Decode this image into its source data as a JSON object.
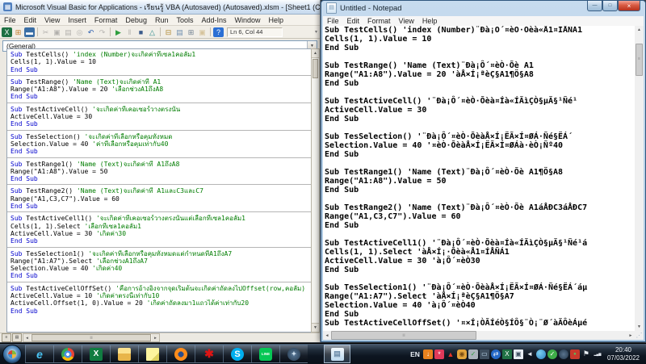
{
  "vba": {
    "title": "Microsoft Visual Basic for Applications - เรียนรู้ VBA (Autosaved) (Autosaved).xlsm - [Sheet1 (Code)]",
    "icon_glyph": "▦",
    "menus": [
      "File",
      "Edit",
      "View",
      "Insert",
      "Format",
      "Debug",
      "Run",
      "Tools",
      "Add-Ins",
      "Window",
      "Help"
    ],
    "status": "Ln 6, Col 44",
    "combo": "(General)",
    "toolbar": [
      {
        "name": "view-excel-icon",
        "glyph": "X",
        "fg": "#ffffff",
        "bg": "#1d6f42",
        "dim": false
      },
      {
        "name": "insert-userform-icon",
        "glyph": "⊞",
        "fg": "#c07a28",
        "bg": "",
        "dim": false
      },
      {
        "name": "save-icon",
        "glyph": "▬",
        "fg": "#ffffff",
        "bg": "#3a6ea5",
        "dim": false
      },
      {
        "name": "cut-icon",
        "glyph": "✂",
        "fg": "#555555",
        "bg": "",
        "dim": true
      },
      {
        "name": "copy-icon",
        "glyph": "▣",
        "fg": "#555555",
        "bg": "",
        "dim": true
      },
      {
        "name": "paste-icon",
        "glyph": "▤",
        "fg": "#555555",
        "bg": "",
        "dim": true
      },
      {
        "name": "find-icon",
        "glyph": "◎",
        "fg": "#555555",
        "bg": "",
        "dim": true
      },
      {
        "name": "undo-icon",
        "glyph": "↶",
        "fg": "#2b5fb0",
        "bg": "",
        "dim": false
      },
      {
        "name": "redo-icon",
        "glyph": "↷",
        "fg": "#666666",
        "bg": "",
        "dim": true
      },
      {
        "name": "run-icon",
        "glyph": "▶",
        "fg": "#2e9e3e",
        "bg": "",
        "dim": false
      },
      {
        "name": "break-icon",
        "glyph": "‖",
        "fg": "#555555",
        "bg": "",
        "dim": true
      },
      {
        "name": "reset-icon",
        "glyph": "■",
        "fg": "#3a5a8a",
        "bg": "",
        "dim": false
      },
      {
        "name": "design-mode-icon",
        "glyph": "△",
        "fg": "#2a8a8a",
        "bg": "",
        "dim": false
      },
      {
        "name": "project-explorer-icon",
        "glyph": "⊟",
        "fg": "#b08830",
        "bg": "",
        "dim": false
      },
      {
        "name": "properties-window-icon",
        "glyph": "▤",
        "fg": "#7090b0",
        "bg": "",
        "dim": false
      },
      {
        "name": "object-browser-icon",
        "glyph": "⊞",
        "fg": "#708090",
        "bg": "",
        "dim": false
      },
      {
        "name": "toolbox-icon",
        "glyph": "▣",
        "fg": "#b08830",
        "bg": "",
        "dim": true
      },
      {
        "name": "help-icon",
        "glyph": "?",
        "fg": "#ffffff",
        "bg": "#2b6fd4",
        "dim": false
      }
    ],
    "blocks": [
      [
        {
          "kw": "Sub",
          "code": " TestCells() ",
          "cmt": "'index (Number)จะเกิดค่าที่เซล1คอลัม1"
        },
        {
          "code": "Cells(1, 1).Value = 10"
        },
        {
          "kw": "End Sub"
        }
      ],
      [
        {
          "kw": "Sub",
          "code": " TestRange() ",
          "cmt": "'Name (Text)จะเกิดค่าที่ A1"
        },
        {
          "code": "Range(\"A1:A8\").Value = 20 ",
          "cmt": "'เลือกช่วงA1ถึงA8"
        },
        {
          "kw": "End Sub"
        }
      ],
      [
        {
          "kw": "Sub",
          "code": " TestActiveCell() ",
          "cmt": "'จะเกิดค่าที่เคอเซอร์วางตรงนั้น"
        },
        {
          "code": "ActiveCell.Value = 30"
        },
        {
          "kw": "End Sub"
        }
      ],
      [
        {
          "kw": "Sub",
          "code": " TesSelection() ",
          "cmt": "'จะเกิดค่าที่เลือกหรือคุมทั้งหมด"
        },
        {
          "code": "Selection.Value = 40 ",
          "cmt": "'ค่าที่เลือกหรือคุมเท่ากับ40"
        },
        {
          "kw": "End Sub"
        }
      ],
      [
        {
          "kw": "Sub",
          "code": " TestRange1() ",
          "cmt": "'Name (Text)จะเกิดค่าที่ A1ถึงA8"
        },
        {
          "code": "Range(\"A1:A8\").Value = 50"
        },
        {
          "kw": "End Sub"
        }
      ],
      [
        {
          "kw": "Sub",
          "code": " TestRange2() ",
          "cmt": "'Name (Text)จะเกิดค่าที่ A1และC3และC7"
        },
        {
          "code": "Range(\"A1,C3,C7\").Value = 60"
        },
        {
          "kw": "End Sub"
        }
      ],
      [
        {
          "kw": "Sub",
          "code": " TestActiveCell1() ",
          "cmt": "'จะเกิดค่าที่เคอเซอร์วางตรงนั้นแต่เลือกที่เซล1คอลัม1"
        },
        {
          "code": "Cells(1, 1).Select ",
          "cmt": "'เลือกที่เซล1คอลัม1"
        },
        {
          "code": "ActiveCell.Value = 30 ",
          "cmt": "'เกิดค่า30"
        },
        {
          "kw": "End Sub"
        }
      ],
      [
        {
          "kw": "Sub",
          "code": " TesSelection1() ",
          "cmt": "'จะเกิดค่าที่เลือกหรือคุมทั้งหมดแต่กำหนดที่A1ถึงA7"
        },
        {
          "code": "Range(\"A1:A7\").Select ",
          "cmt": "'เลือกช่วงA1ถึงA7"
        },
        {
          "code": "Selection.Value = 40 ",
          "cmt": "'เกิดค่า40"
        },
        {
          "kw": "End Sub"
        }
      ],
      [
        {
          "kw": "Sub",
          "code": " TestActiveCellOffSet() ",
          "cmt": "'คือการอ้างอิงจากจุดเริ่มต้นจะเกิดค่าถัดลงไปOffset(row,คอลัม)"
        },
        {
          "code": "ActiveCell.Value = 10 ",
          "cmt": "'เกิดค่าตรงนี้เท่ากับ10"
        },
        {
          "code": "ActiveCell.Offset(1, 0).Value = 20 ",
          "cmt": "'เกิดค่าถัดลงมา1แถวได้ค่าเท่ากับ20"
        },
        {
          "kw": "End Sub"
        }
      ]
    ]
  },
  "notepad": {
    "title": "Untitled - Notepad",
    "icon_glyph": "▤",
    "menus": [
      "File",
      "Edit",
      "Format",
      "View",
      "Help"
    ],
    "lines": [
      "Sub TestCells() 'index (Number)¨Ðà¡Ô´¤èÒ·Õèà«Å1¤ÍÅÑÁ1",
      "Cells(1, 1).Value = 10",
      "End Sub",
      "",
      "Sub TestRange() 'Name (Text)¨Ðà¡Ô´¤èÒ·Õè A1",
      "Range(\"A1:A8\").Value = 20 'àÅ×Í¡ªèÇ§A1¶Ö§A8",
      "End Sub",
      "",
      "Sub TestActiveCell() '¨Ðà¡Ô´¤èÒ·Õèà¤Íà«ÍÃìÇÒ§µÃ§¹Ñé¹",
      "ActiveCell.Value = 30",
      "End Sub",
      "",
      "Sub TesSelection() '¨Ðà¡Ô´¤èÒ·ÕèàÅ×Í¡ËÃ×Í¤ØÁ·Ñé§ËÁ´",
      "Selection.Value = 40 '¤èÒ·ÕèàÅ×Í¡ËÃ×Í¤ØÁà·èÒ¡Ñº40",
      "End Sub",
      "",
      "Sub TestRange1() 'Name (Text)¨Ðà¡Ô´¤èÒ·Õè A1¶Ö§A8",
      "Range(\"A1:A8\").Value = 50",
      "End Sub",
      "",
      "Sub TestRange2() 'Name (Text)¨Ðà¡Ô´¤èÒ·Õè A1áÅÐC3áÅÐC7",
      "Range(\"A1,C3,C7\").Value = 60",
      "End Sub",
      "",
      "Sub TestActiveCell1() '¨Ðà¡Ô´¤èÒ·Õèà¤Íà«ÍÃìÇÒ§µÃ§¹Ñé¹á",
      "Cells(1, 1).Select 'àÅ×Í¡·Õèà«Å1¤ÍÅÑÁ1",
      "ActiveCell.Value = 30 'à¡Ô´¤èÒ30",
      "End Sub",
      "",
      "Sub TesSelection1() '¨Ðà¡Ô´¤èÒ·ÕèàÅ×Í¡ËÃ×Í¤ØÁ·Ñé§ËÁ´áµ",
      "Range(\"A1:A7\").Select 'àÅ×Í¡ªèÇ§A1¶Ö§A7",
      "Selection.Value = 40 'à¡Ô´¤èÒ40",
      "End Sub",
      "Sub TestActiveCellOffSet() '¤×Í¡ÒÃÍéÒ§ÍÔ§¨Ò¡¨Ø´àÃÔèÁµé"
    ]
  },
  "taskbar": {
    "apps": [
      {
        "name": "internet-explorer-icon",
        "glyph": "e",
        "fg": "#49c2f1",
        "bg": "",
        "radius": "0",
        "fs": "14px",
        "italic": true
      },
      {
        "name": "chrome-icon",
        "glyph": "",
        "fg": "",
        "bg": "radial-gradient(circle,#ffffff 0 2px,#4a90e2 2px 4.5px,rgba(0,0,0,0) 4.5px),conic-gradient(#ea4335 0deg 120deg,#fbbc05 120deg 240deg,#34a853 240deg 360deg)",
        "radius": "50%",
        "fs": "9px",
        "italic": false
      },
      {
        "name": "excel-icon",
        "glyph": "X",
        "fg": "#ffffff",
        "bg": "#107c41",
        "radius": "2px",
        "fs": "10px",
        "italic": false
      },
      {
        "name": "file-explorer-icon",
        "glyph": "",
        "fg": "",
        "bg": "linear-gradient(#fce28e 45%,#e8b54a 45%)",
        "radius": "2px",
        "fs": "9px",
        "italic": false
      },
      {
        "name": "sticky-notes-icon",
        "glyph": "",
        "fg": "",
        "bg": "linear-gradient(135deg,#fdf49e 68%,#ded160 68%)",
        "radius": "1px",
        "fs": "9px",
        "italic": false
      },
      {
        "name": "firefox-icon",
        "glyph": "",
        "fg": "",
        "bg": "radial-gradient(circle,#2b4d8c 0 3.5px,#ff8c1a 3.5px 8px)",
        "radius": "50%",
        "fs": "9px",
        "italic": false
      },
      {
        "name": "red-app-icon",
        "glyph": "✱",
        "fg": "#e01414",
        "bg": "",
        "radius": "0",
        "fs": "14px",
        "italic": false
      },
      {
        "name": "skype-icon",
        "glyph": "S",
        "fg": "#ffffff",
        "bg": "#00aff0",
        "radius": "50%",
        "fs": "11px",
        "italic": false
      },
      {
        "name": "line-icon",
        "glyph": "LINE",
        "fg": "#ffffff",
        "bg": "#06c755",
        "radius": "3px",
        "fs": "4.5px",
        "italic": false
      },
      {
        "name": "security-globe-icon",
        "glyph": "✦",
        "fg": "#cfe0ee",
        "bg": "radial-gradient(circle,#5a7a9a,#24384c)",
        "radius": "50%",
        "fs": "8px",
        "italic": false
      }
    ],
    "active_app": {
      "name": "notepad-icon",
      "glyph": "▤",
      "fg": "#6a8aa8",
      "bg": "linear-gradient(#f4fafe,#bcd8ee)",
      "radius": "2px",
      "fs": "9px",
      "italic": false
    },
    "language_indicator": "EN",
    "tray_icons": [
      {
        "name": "downloader-tray-icon",
        "glyph": "↓",
        "fg": "#ffffff",
        "bg": "#e8821e",
        "radius": "2px",
        "fs": "8px"
      },
      {
        "name": "red-badge-tray-icon",
        "glyph": "*",
        "fg": "#ffffff",
        "bg": "#e03a5a",
        "radius": "2px",
        "fs": "9px"
      },
      {
        "name": "red-triangle-tray-icon",
        "glyph": "▲",
        "fg": "#e23324",
        "bg": "",
        "radius": "0",
        "fs": "9px"
      },
      {
        "name": "yellow-app-tray-icon",
        "glyph": "◉",
        "fg": "#7a4d12",
        "bg": "#e0a33c",
        "radius": "3px",
        "fs": "8px"
      },
      {
        "name": "phone-shield-tray-icon",
        "glyph": "✓",
        "fg": "#2f9e3f",
        "bg": "#aab4bc",
        "radius": "2px",
        "fs": "8px"
      },
      {
        "name": "monitor-tray-icon",
        "glyph": "▭",
        "fg": "#cfeeff",
        "bg": "#3e4e5e",
        "radius": "1px",
        "fs": "8px"
      },
      {
        "name": "teamviewer-tray-icon",
        "glyph": "⇄",
        "fg": "#ffffff",
        "bg": "#2569c8",
        "radius": "50%",
        "fs": "8px"
      },
      {
        "name": "excel-tray-icon",
        "glyph": "X",
        "fg": "#ffffff",
        "bg": "#207245",
        "radius": "1px",
        "fs": "8px"
      },
      {
        "name": "window-tray-icon",
        "glyph": "▣",
        "fg": "#445566",
        "bg": "#e8eef4",
        "radius": "1px",
        "fs": "8px"
      },
      {
        "name": "volume-tray-icon",
        "glyph": "◄",
        "fg": "#dfe6ee",
        "bg": "",
        "radius": "0",
        "fs": "8px"
      },
      {
        "name": "network-globe-tray-icon",
        "glyph": "",
        "fg": "",
        "bg": "radial-gradient(circle at 35% 35%,#7cd0f0,#2b7fc0)",
        "radius": "50%",
        "fs": "8px"
      },
      {
        "name": "green-check-tray-icon",
        "glyph": "✓",
        "fg": "#ffffff",
        "bg": "#3fae49",
        "radius": "50%",
        "fs": "8px"
      },
      {
        "name": "dark-globe-tray-icon",
        "glyph": "",
        "fg": "",
        "bg": "radial-gradient(circle,#5a748e,#203448)",
        "radius": "50%",
        "fs": "8px"
      },
      {
        "name": "chat-red-tray-icon",
        "glyph": "●",
        "fg": "#57c15b",
        "bg": "#c8392c",
        "radius": "2px",
        "fs": "6px"
      },
      {
        "name": "action-center-flag-icon",
        "glyph": "⚑",
        "fg": "#e8eef4",
        "bg": "",
        "radius": "0",
        "fs": "9px"
      },
      {
        "name": "network-signal-icon",
        "glyph": "▂▄▆",
        "fg": "#dfe6ee",
        "bg": "",
        "radius": "0",
        "fs": "4px"
      }
    ],
    "clock": {
      "time": "20:40",
      "date": "07/03/2022"
    }
  }
}
